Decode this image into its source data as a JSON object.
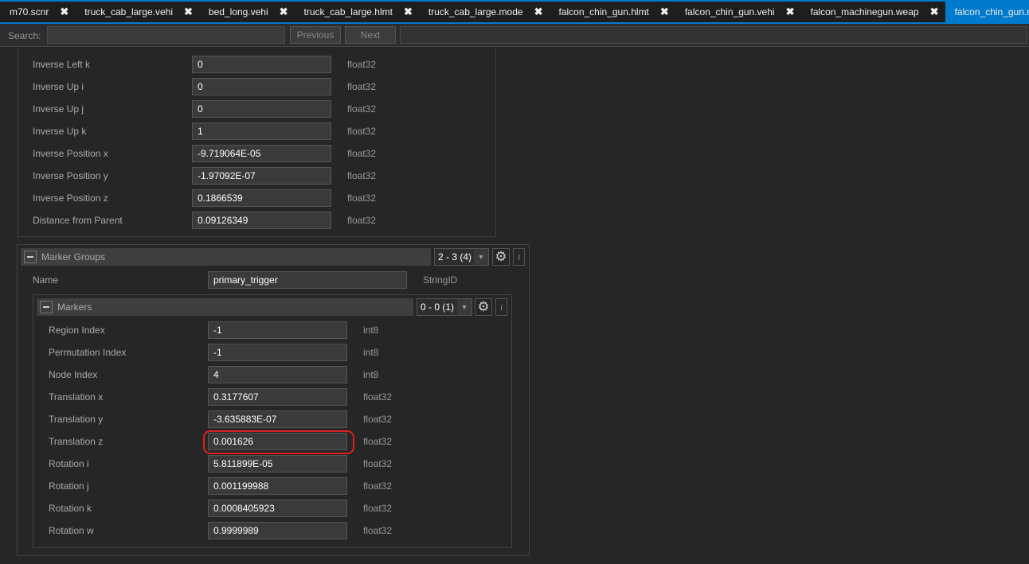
{
  "tabs": [
    {
      "label": "m70.scnr",
      "active": false
    },
    {
      "label": "truck_cab_large.vehi",
      "active": false
    },
    {
      "label": "bed_long.vehi",
      "active": false
    },
    {
      "label": "truck_cab_large.hlmt",
      "active": false
    },
    {
      "label": "truck_cab_large.mode",
      "active": false
    },
    {
      "label": "falcon_chin_gun.hlmt",
      "active": false
    },
    {
      "label": "falcon_chin_gun.vehi",
      "active": false
    },
    {
      "label": "falcon_machinegun.weap",
      "active": false
    },
    {
      "label": "falcon_chin_gun.mode",
      "active": true
    }
  ],
  "close_glyph": "✖",
  "search": {
    "label": "Search:",
    "value": "",
    "previous": "Previous",
    "next": "Next"
  },
  "upper_fields": [
    {
      "label": "Inverse Left k",
      "value": "0",
      "type": "float32"
    },
    {
      "label": "Inverse Up i",
      "value": "0",
      "type": "float32"
    },
    {
      "label": "Inverse Up j",
      "value": "0",
      "type": "float32"
    },
    {
      "label": "Inverse Up k",
      "value": "1",
      "type": "float32"
    },
    {
      "label": "Inverse Position x",
      "value": "-9.719064E-05",
      "type": "float32"
    },
    {
      "label": "Inverse Position y",
      "value": "-1.97092E-07",
      "type": "float32"
    },
    {
      "label": "Inverse Position z",
      "value": "0.1866539",
      "type": "float32"
    },
    {
      "label": "Distance from Parent",
      "value": "0.09126349",
      "type": "float32"
    }
  ],
  "marker_groups": {
    "title": "Marker Groups",
    "range": "2 - 3 (4)",
    "name_label": "Name",
    "name_value": "primary_trigger",
    "name_type": "StringID"
  },
  "markers": {
    "title": "Markers",
    "range": "0 - 0 (1)",
    "fields": [
      {
        "label": "Region Index",
        "value": "-1",
        "type": "int8"
      },
      {
        "label": "Permutation Index",
        "value": "-1",
        "type": "int8"
      },
      {
        "label": "Node Index",
        "value": "4",
        "type": "int8"
      },
      {
        "label": "Translation x",
        "value": "0.3177607",
        "type": "float32"
      },
      {
        "label": "Translation y",
        "value": "-3.635883E-07",
        "type": "float32"
      },
      {
        "label": "Translation z",
        "value": "0.001626",
        "type": "float32",
        "highlighted": true
      },
      {
        "label": "Rotation i",
        "value": "5.811899E-05",
        "type": "float32"
      },
      {
        "label": "Rotation j",
        "value": "0.001199988",
        "type": "float32"
      },
      {
        "label": "Rotation k",
        "value": "0.0008405923",
        "type": "float32"
      },
      {
        "label": "Rotation w",
        "value": "0.9999989",
        "type": "float32"
      }
    ]
  },
  "colors": {
    "accent": "#007acc",
    "highlight": "#e02020"
  }
}
